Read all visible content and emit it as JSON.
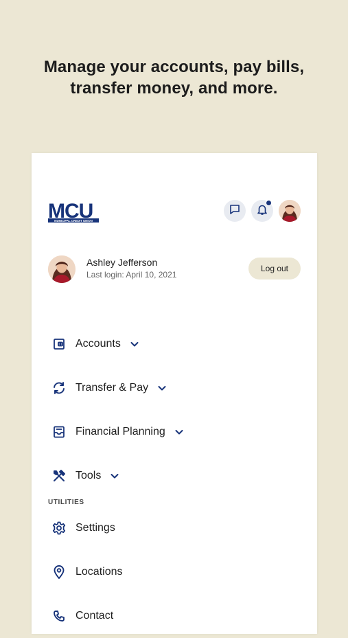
{
  "headline": {
    "line1": "Manage your accounts, pay bills,",
    "line2": "transfer money, and more."
  },
  "brand": {
    "logo_text": "MCU",
    "logo_subtext": "MUNICIPAL CREDIT UNION",
    "primary_color": "#17337a",
    "background_color": "#ece7d4"
  },
  "header": {
    "icons": [
      "chat-icon",
      "bell-icon",
      "avatar"
    ]
  },
  "profile": {
    "name": "Ashley Jefferson",
    "last_login": "Last login: April 10, 2021",
    "logout_label": "Log out"
  },
  "nav": {
    "items": [
      {
        "label": "Accounts",
        "icon": "wallet-icon"
      },
      {
        "label": "Transfer & Pay",
        "icon": "transfer-icon"
      },
      {
        "label": "Financial Planning",
        "icon": "planning-icon"
      },
      {
        "label": "Tools",
        "icon": "tools-icon"
      }
    ]
  },
  "utilities": {
    "section_label": "UTILITIES",
    "items": [
      {
        "label": "Settings",
        "icon": "gear-icon"
      },
      {
        "label": "Locations",
        "icon": "location-pin-icon"
      },
      {
        "label": "Contact",
        "icon": "phone-icon"
      }
    ]
  }
}
